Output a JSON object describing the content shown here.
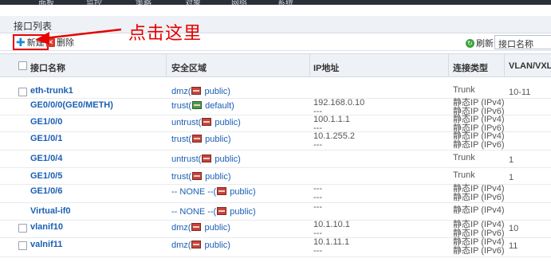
{
  "topnav": {
    "items": [
      "面板",
      "监控",
      "策略",
      "对象",
      "网络",
      "系统"
    ]
  },
  "panel": {
    "title": "接口列表"
  },
  "toolbar": {
    "new_label": "新建",
    "delete_label": "删除",
    "refresh_label": "刷新",
    "search_value": "接口名称"
  },
  "annotation": {
    "text": "点击这里",
    "color": "#e60000"
  },
  "table": {
    "headers": {
      "name": "接口名称",
      "zone": "安全区域",
      "ip": "IP地址",
      "conn": "连接类型",
      "vlan": "VLAN/VXLA"
    },
    "rows": [
      {
        "name": "eth-trunk1",
        "zone_prefix": "dmz(",
        "zone_suffix": " public)",
        "ip1": "",
        "ip2": "",
        "conn1": "Trunk",
        "conn2": "",
        "vlan": "10-11"
      },
      {
        "name": "GE0/0/0(GE0/METH)",
        "zone_prefix": "trust(",
        "zone_suffix": " default)",
        "ip1": "192.168.0.10",
        "ip2": "---",
        "conn1": "静态IP (IPv4)",
        "conn2": "静态IP (IPv6)",
        "vlan": ""
      },
      {
        "name": "GE1/0/0",
        "zone_prefix": "untrust(",
        "zone_suffix": " public)",
        "ip1": "100.1.1.1",
        "ip2": "---",
        "conn1": "静态IP (IPv4)",
        "conn2": "静态IP (IPv6)",
        "vlan": ""
      },
      {
        "name": "GE1/0/1",
        "zone_prefix": "trust(",
        "zone_suffix": " public)",
        "ip1": "10.1.255.2",
        "ip2": "---",
        "conn1": "静态IP (IPv4)",
        "conn2": "静态IP (IPv6)",
        "vlan": ""
      },
      {
        "name": "GE1/0/4",
        "zone_prefix": "untrust(",
        "zone_suffix": " public)",
        "ip1": "",
        "ip2": "",
        "conn1": "Trunk",
        "conn2": "",
        "vlan": "1"
      },
      {
        "name": "GE1/0/5",
        "zone_prefix": "trust(",
        "zone_suffix": " public)",
        "ip1": "",
        "ip2": "",
        "conn1": "Trunk",
        "conn2": "",
        "vlan": "1"
      },
      {
        "name": "GE1/0/6",
        "zone_prefix": "-- NONE --(",
        "zone_suffix": " public)",
        "ip1": "---",
        "ip2": "---",
        "conn1": "静态IP (IPv4)",
        "conn2": "静态IP (IPv6)",
        "vlan": ""
      },
      {
        "name": "Virtual-if0",
        "zone_prefix": "-- NONE --(",
        "zone_suffix": " public)",
        "ip1": "---",
        "ip2": "",
        "conn1": "静态IP (IPv4)",
        "conn2": "",
        "vlan": ""
      },
      {
        "name": "vlanif10",
        "zone_prefix": "dmz(",
        "zone_suffix": " public)",
        "ip1": "10.1.10.1",
        "ip2": "---",
        "conn1": "静态IP (IPv4)",
        "conn2": "静态IP (IPv6)",
        "vlan": "10"
      },
      {
        "name": "valnif11",
        "zone_prefix": "dmz(",
        "zone_suffix": " public)",
        "ip1": "10.1.11.1",
        "ip2": "---",
        "conn1": "静态IP (IPv4)",
        "conn2": "静态IP (IPv6)",
        "vlan": "11"
      }
    ]
  }
}
